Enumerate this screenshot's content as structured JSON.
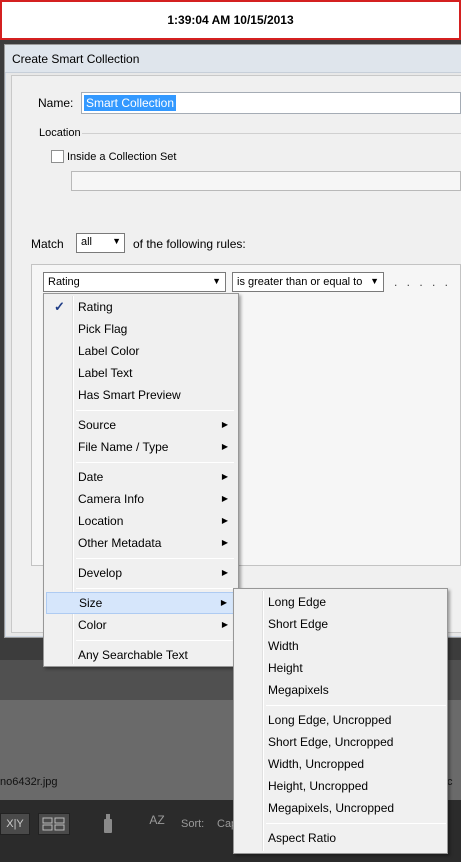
{
  "banner": {
    "timestamp": "1:39:04 AM 10/15/2013"
  },
  "background": {
    "filename": "no6432r.jpg",
    "filename_right": "c"
  },
  "dialog": {
    "title": "Create Smart Collection",
    "name_label": "Name:",
    "name_value": "Smart Collection",
    "location_label": "Location",
    "inside_set_label": "Inside a Collection Set",
    "inside_set_checked": false,
    "match_label": "Match",
    "match_value": "all",
    "rules_label": "of the following rules:",
    "criterion_value": "Rating",
    "operator_value": "is greater than or equal to",
    "value_dots": ". . . . ."
  },
  "menu_main": {
    "items": [
      {
        "label": "Rating",
        "checked": true
      },
      {
        "label": "Pick Flag"
      },
      {
        "label": "Label Color"
      },
      {
        "label": "Label Text"
      },
      {
        "label": "Has Smart Preview"
      },
      {
        "label": "Source",
        "submenu": true
      },
      {
        "label": "File Name / Type",
        "submenu": true
      },
      {
        "label": "Date",
        "submenu": true
      },
      {
        "label": "Camera Info",
        "submenu": true
      },
      {
        "label": "Location",
        "submenu": true
      },
      {
        "label": "Other Metadata",
        "submenu": true
      },
      {
        "label": "Develop",
        "submenu": true
      },
      {
        "label": "Size",
        "submenu": true,
        "highlighted": true
      },
      {
        "label": "Color",
        "submenu": true
      },
      {
        "label": "Any Searchable Text"
      }
    ]
  },
  "menu_sub": {
    "items": [
      {
        "label": "Long Edge"
      },
      {
        "label": "Short Edge"
      },
      {
        "label": "Width"
      },
      {
        "label": "Height"
      },
      {
        "label": "Megapixels"
      },
      {
        "label": "Long Edge, Uncropped"
      },
      {
        "label": "Short Edge, Uncropped"
      },
      {
        "label": "Width, Uncropped"
      },
      {
        "label": "Height, Uncropped"
      },
      {
        "label": "Megapixels, Uncropped"
      },
      {
        "label": "Aspect Ratio"
      }
    ]
  },
  "toolbar": {
    "xy_label": "X|Y",
    "sort_label": "Sort:",
    "sort_value": "Cap",
    "sort_az_label": "AZ"
  },
  "colors": {
    "highlight": "#d6e6fb",
    "selection": "#3399ff",
    "banner_border": "#d42020"
  }
}
